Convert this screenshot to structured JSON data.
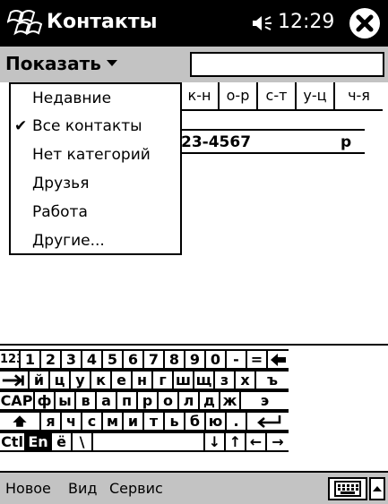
{
  "titlebar": {
    "app_title": "Контакты",
    "clock": "12:29",
    "start_icon": "windows-flag-icon",
    "speaker_icon": "speaker-icon",
    "close_icon": "close-icon"
  },
  "toolbar": {
    "show_menu_label": "Показать",
    "search_value": ""
  },
  "alpha_tabs": [
    "к-н",
    "о-р",
    "с-т",
    "у-ц",
    "ч-я"
  ],
  "contact": {
    "phone": "23-4567",
    "type": "р"
  },
  "dropdown": {
    "items": [
      {
        "label": "Недавние",
        "checked": false
      },
      {
        "label": "Все контакты",
        "checked": true
      },
      {
        "label": "Нет категорий",
        "checked": false
      },
      {
        "label": "Друзья",
        "checked": false
      },
      {
        "label": "Работа",
        "checked": false
      },
      {
        "label": "Другие...",
        "checked": false
      }
    ],
    "check_glyph": "✔"
  },
  "keyboard": {
    "row1": [
      "123",
      "1",
      "2",
      "3",
      "4",
      "5",
      "6",
      "7",
      "8",
      "9",
      "0",
      "-",
      "=",
      "backspace-icon"
    ],
    "row2": [
      "tab-icon",
      "й",
      "ц",
      "у",
      "к",
      "е",
      "н",
      "г",
      "ш",
      "щ",
      "з",
      "х",
      "ъ"
    ],
    "row3": [
      "CAP",
      "ф",
      "ы",
      "в",
      "а",
      "п",
      "р",
      "о",
      "л",
      "д",
      "ж",
      "э"
    ],
    "row4": [
      "shift-icon",
      "я",
      "ч",
      "с",
      "м",
      "и",
      "т",
      "ь",
      "б",
      "ю",
      ".",
      "enter-icon"
    ],
    "row5": [
      "Ctl",
      "En",
      "ё",
      "\\",
      "",
      "↓",
      "↑",
      "←",
      "→"
    ]
  },
  "menubar": {
    "items": [
      "Новое",
      "Вид",
      "Сервис"
    ],
    "sip_icon": "keyboard-icon",
    "sip_arrow_icon": "up-arrow-icon"
  }
}
